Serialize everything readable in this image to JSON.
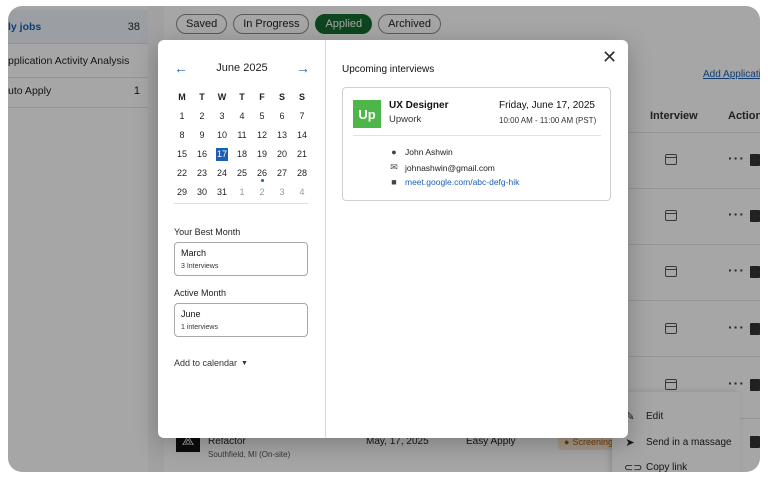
{
  "sidebar": {
    "items": [
      {
        "label": "ly jobs",
        "count": "38"
      },
      {
        "label": "pplication Activity Analysis",
        "count": ""
      },
      {
        "label": "uto Apply",
        "count": "1"
      }
    ]
  },
  "filters": {
    "chips": [
      {
        "label": "Saved"
      },
      {
        "label": "In Progress"
      },
      {
        "label": "Applied"
      },
      {
        "label": "Archived"
      }
    ]
  },
  "table": {
    "add_link": "Add Applicatio",
    "col_interview": "Interview",
    "col_actions": "Actions"
  },
  "bottom_job": {
    "role": "Refactor",
    "location": "Southfield, MI (On-site)",
    "date": "May, 17, 2025",
    "source": "Easy Apply",
    "status": "Screening"
  },
  "context_menu": {
    "edit": "Edit",
    "send": "Send in a massage",
    "copy": "Copy link"
  },
  "calendar": {
    "month_label": "June 2025",
    "weekdays": [
      "M",
      "T",
      "W",
      "T",
      "F",
      "S",
      "S"
    ],
    "weeks": [
      [
        "1",
        "2",
        "3",
        "4",
        "5",
        "6",
        "7"
      ],
      [
        "8",
        "9",
        "10",
        "11",
        "12",
        "13",
        "14"
      ],
      [
        "15",
        "16",
        "17",
        "18",
        "19",
        "20",
        "21"
      ],
      [
        "22",
        "23",
        "24",
        "25",
        "26",
        "27",
        "28"
      ],
      [
        "29",
        "30",
        "31",
        "1",
        "2",
        "3",
        "4"
      ]
    ],
    "selected_day": "17",
    "dot_day": "26",
    "best_month_label": "Your Best Month",
    "best_month": "March",
    "best_month_count": "3 Interviews",
    "active_month_label": "Active Month",
    "active_month": "June",
    "active_month_count": "1 interviews",
    "add_to_calendar": "Add to calendar"
  },
  "interviews": {
    "heading": "Upcoming interviews",
    "card": {
      "logo_text": "Up",
      "job_title": "UX Designer",
      "company": "Upwork",
      "date": "Friday, June 17, 2025",
      "time": "10:00 AM - 11:00 AM (PST)",
      "contact_name": "John Ashwin",
      "contact_email": "johnashwin@gmail.com",
      "meeting_link": "meet.google.com/abc-defg-hik"
    }
  },
  "colors": {
    "accent": "#1a5fb4",
    "applied_chip": "#146c2e",
    "upwork": "#4cb648"
  }
}
